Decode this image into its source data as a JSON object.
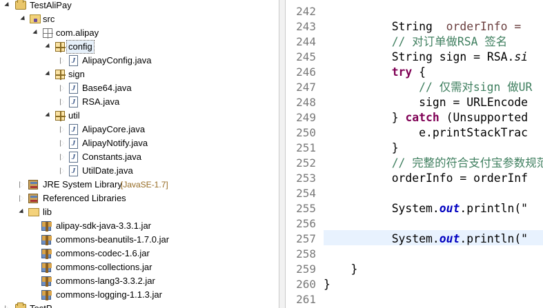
{
  "tree": {
    "project_name": "TestAliPay",
    "src_folder": "src",
    "root_package": "com.alipay",
    "pkg_config": "config",
    "file_alipayconfig": "AlipayConfig.java",
    "pkg_sign": "sign",
    "file_base64": "Base64.java",
    "file_rsa": "RSA.java",
    "pkg_util": "util",
    "file_alipaycore": "AlipayCore.java",
    "file_alipaynotify": "AlipayNotify.java",
    "file_constants": "Constants.java",
    "file_utildate": "UtilDate.java",
    "jre_label": "JRE System Library",
    "jre_decoration": "[JavaSE-1.7]",
    "ref_libs": "Referenced Libraries",
    "lib_folder": "lib",
    "jars": [
      "alipay-sdk-java-3.3.1.jar",
      "commons-beanutils-1.7.0.jar",
      "commons-codec-1.6.jar",
      "commons-collections.jar",
      "commons-lang3-3.3.2.jar",
      "commons-logging-1.1.3.jar"
    ],
    "next_project_partial": "TestP"
  },
  "editor": {
    "line_numbers": [
      "242",
      "243",
      "244",
      "245",
      "246",
      "247",
      "248",
      "249",
      "250",
      "251",
      "252",
      "253",
      "254",
      "255",
      "256",
      "257",
      "258",
      "259",
      "260",
      "261"
    ],
    "highlighted_line": "257",
    "code": {
      "l243_type": "String",
      "l243_rest": "orderInfo = ",
      "l244_comment": "// 对订单做RSA 签名",
      "l245_a": "String sign = RSA.",
      "l245_b": "si",
      "l246_kw": "try",
      "l246_rest": " {",
      "l247_comment": "// 仅需对sign 做UR",
      "l248_a": "sign = URLEncode",
      "l249_a": "} ",
      "l249_kw": "catch",
      "l249_b": " (Unsupported",
      "l250_a": "e.printStackTrac",
      "l251_a": "}",
      "l252_comment": "// 完整的符合支付宝参数规范",
      "l253_a": "orderInfo = orderInf",
      "l255_a": "System.",
      "l255_fld": "out",
      "l255_b": ".println(\"",
      "l257_a": "System.",
      "l257_fld": "out",
      "l257_b": ".println(\"",
      "l259_a": "}",
      "l260_a": "}"
    }
  }
}
